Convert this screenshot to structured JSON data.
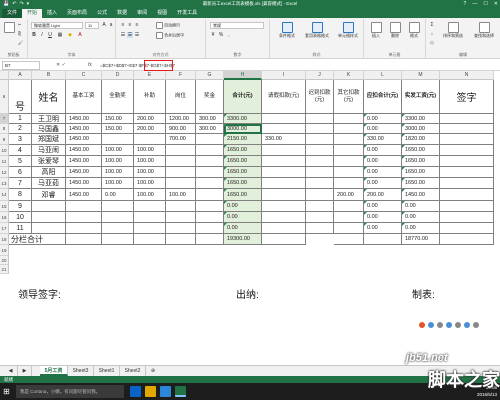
{
  "titlebar": {
    "title": "最新员工excel工资表模板.xls [兼容模式] - Excel",
    "qat": [
      "💾",
      "↶",
      "↷",
      "▾"
    ],
    "controls": [
      "?",
      "—",
      "☐",
      "✕"
    ]
  },
  "menu": {
    "tabs": [
      "文件",
      "开始",
      "插入",
      "页面布局",
      "公式",
      "数据",
      "审阅",
      "视图",
      "开发工具"
    ]
  },
  "ribbon": {
    "clipboard_label": "剪贴板",
    "font_name": "微软雅黑 Light",
    "font_size": "11",
    "font_label": "字体",
    "align_label": "对齐方式",
    "wrap_text": "自动换行",
    "merge_center": "合并后居中",
    "number_format": "常规",
    "number_label": "数字",
    "cond_format": "条件格式",
    "table_format": "套用表格格式",
    "cell_style": "单元格样式",
    "styles_label": "样式",
    "insert": "插入",
    "delete": "删除",
    "format": "格式",
    "cells_label": "单元格",
    "sort_filter": "排序和筛选",
    "find_select": "查找和选择",
    "edit_label": "编辑"
  },
  "formula_bar": {
    "name_box": "B7",
    "formula": "=$C$7+$D$7+E$7-$F$7-$G$7+$H$7"
  },
  "columns": [
    "A",
    "B",
    "C",
    "D",
    "E",
    "F",
    "G",
    "H",
    "I",
    "J",
    "K",
    "L",
    "M",
    "N"
  ],
  "row_numbers": [
    "6",
    "7",
    "8",
    "9",
    "10",
    "11",
    "12",
    "13",
    "14",
    "15",
    "16",
    "17",
    "18",
    "19",
    "20",
    "21"
  ],
  "sheet": {
    "header": {
      "no": "号",
      "name": "姓名",
      "basic": "基本工资",
      "bonus": "全勤奖",
      "subsidy": "补助",
      "post": "岗位",
      "award": "奖金",
      "total": "合计(元)",
      "leave": "请假扣款(元)",
      "late": "迟到扣款(元)",
      "other": "其它扣款(元)",
      "deduct": "应扣合计(元)",
      "actual": "实发工资(元)",
      "sign": "签字"
    },
    "rows": [
      {
        "no": "1",
        "name": "王卫明",
        "basic": "1450.00",
        "bonus": "150.00",
        "subsidy": "200.00",
        "post": "1200.00",
        "award": "300.00",
        "total": "3300.00",
        "leave": "",
        "late": "",
        "other": "",
        "deduct": "0.00",
        "actual": "3300.00"
      },
      {
        "no": "2",
        "name": "马国鑫",
        "basic": "1450.00",
        "bonus": "150.00",
        "subsidy": "200.00",
        "post": "900.00",
        "award": "300.00",
        "total": "3000.00",
        "leave": "",
        "late": "",
        "other": "",
        "deduct": "0.00",
        "actual": "3000.00"
      },
      {
        "no": "3",
        "name": "郑国斌",
        "basic": "1450.00",
        "bonus": "",
        "subsidy": "",
        "post": "700.00",
        "award": "",
        "total": "2150.00",
        "leave": "330.00",
        "late": "",
        "other": "",
        "deduct": "330.00",
        "actual": "1820.00"
      },
      {
        "no": "4",
        "name": "马亚闹",
        "basic": "1450.00",
        "bonus": "100.00",
        "subsidy": "100.00",
        "post": "",
        "award": "",
        "total": "1650.00",
        "leave": "",
        "late": "",
        "other": "",
        "deduct": "0.00",
        "actual": "1650.00"
      },
      {
        "no": "5",
        "name": "张爱琴",
        "basic": "1450.00",
        "bonus": "100.00",
        "subsidy": "100.00",
        "post": "",
        "award": "",
        "total": "1650.00",
        "leave": "",
        "late": "",
        "other": "",
        "deduct": "0.00",
        "actual": "1650.00"
      },
      {
        "no": "6",
        "name": "高阳",
        "basic": "1450.00",
        "bonus": "100.00",
        "subsidy": "100.00",
        "post": "",
        "award": "",
        "total": "1650.00",
        "leave": "",
        "late": "",
        "other": "",
        "deduct": "0.00",
        "actual": "1650.00"
      },
      {
        "no": "7",
        "name": "马亚茹",
        "basic": "1450.00",
        "bonus": "100.00",
        "subsidy": "100.00",
        "post": "",
        "award": "",
        "total": "1650.00",
        "leave": "",
        "late": "",
        "other": "",
        "deduct": "0.00",
        "actual": "1650.00"
      },
      {
        "no": "8",
        "name": "邓睿",
        "basic": "1450.00",
        "bonus": "0.00",
        "subsidy": "100.00",
        "post": "100.00",
        "award": "",
        "total": "1650.00",
        "leave": "",
        "late": "",
        "other": "200.00",
        "deduct": "200.00",
        "actual": "1450.00"
      },
      {
        "no": "9",
        "name": "",
        "basic": "",
        "bonus": "",
        "subsidy": "",
        "post": "",
        "award": "",
        "total": "0.00",
        "leave": "",
        "late": "",
        "other": "",
        "deduct": "0.00",
        "actual": "0.00"
      },
      {
        "no": "10",
        "name": "",
        "basic": "",
        "bonus": "",
        "subsidy": "",
        "post": "",
        "award": "",
        "total": "0.00",
        "leave": "",
        "late": "",
        "other": "",
        "deduct": "0.00",
        "actual": "0.00"
      },
      {
        "no": "11",
        "name": "",
        "basic": "",
        "bonus": "",
        "subsidy": "",
        "post": "",
        "award": "",
        "total": "0.00",
        "leave": "",
        "late": "",
        "other": "",
        "deduct": "0.00",
        "actual": "0.00"
      }
    ],
    "subtotal_label": "分栏合计",
    "subtotal_total": "19300.00",
    "subtotal_actual": "18770.00",
    "leader_sign": "领导签字:",
    "cashier": "出纳:",
    "maker": "制表:"
  },
  "sheet_tabs": [
    "5月工资",
    "Sheet3",
    "Sheet1",
    "Sheet2"
  ],
  "status_text": "就绪",
  "taskbar": {
    "search_placeholder": "我是 Cortana，小娜。有问题尽管问我。",
    "time": "14:08",
    "date": "2016/5/13"
  },
  "watermark": {
    "site": "jb51.net",
    "brand": "脚本之家"
  },
  "colors": {
    "excel_green": "#217346",
    "formula_highlight": "#e31b23"
  }
}
